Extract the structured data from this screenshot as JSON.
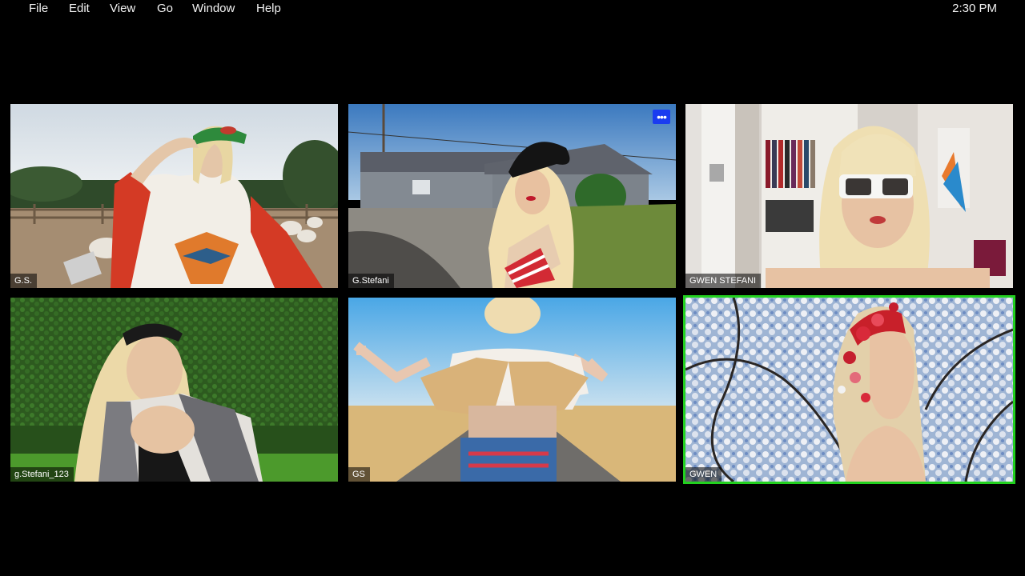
{
  "menubar": {
    "items": [
      "File",
      "Edit",
      "View",
      "Go",
      "Window",
      "Help"
    ],
    "clock": "2:30 PM"
  },
  "grid": {
    "participants": [
      {
        "name": "G.S.",
        "scene": "farm with sheep"
      },
      {
        "name": "G.Stefani",
        "scene": "suburban house driveway",
        "menu_icon": "more-dots-icon"
      },
      {
        "name": "GWEN STEFANI",
        "scene": "walk-in closet"
      },
      {
        "name": "g.Stefani_123",
        "scene": "green hedge wall"
      },
      {
        "name": "GS",
        "scene": "desert road"
      },
      {
        "name": "GWEN",
        "scene": "cherry blossoms",
        "active_speaker": true
      }
    ],
    "colors": {
      "active_border": "#22d11f",
      "menu_button": "#1a3cf0"
    }
  }
}
